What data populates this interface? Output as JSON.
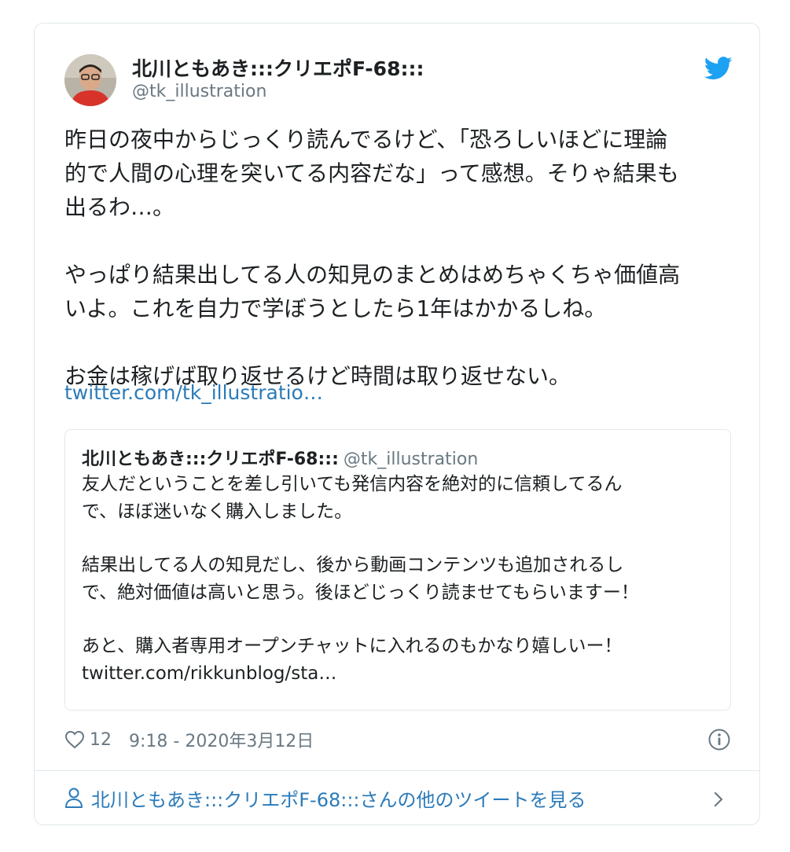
{
  "tweet": {
    "author_name": "北川ともあき:::クリエポF-68:::",
    "author_handle": "@tk_illustration",
    "text_lines": [
      "昨日の夜中からじっくり読んでるけど、「恐ろしいほどに理論",
      "的で人間の心理を突いてる内容だな」って感想。そりゃ結果も",
      "出るわ…。",
      "やっぱり結果出してる人の知見のまとめはめちゃくちゃ価値高",
      "いよ。これを自力で学ぼうとしたら1年はかかるしね。",
      "お金は稼げば取り返せるけど時間は取り返せない。"
    ],
    "link": "twitter.com/tk_illustratio…",
    "likes": "12",
    "timestamp": "9:18 - 2020年3月12日"
  },
  "quoted": {
    "author_name": "北川ともあき:::クリエポF-68:::",
    "author_handle": "@tk_illustration",
    "lines": [
      "友人だということを差し引いても発信内容を絶対的に信頼してるん",
      "で、ほぼ迷いなく購入しました。",
      "結果出してる人の知見だし、後から動画コンテンツも追加されるし",
      "で、絶対価値は高いと思う。後ほどじっくり読ませてもらいますー！",
      "あと、購入者専用オープンチャットに入れるのもかなり嬉しいー！",
      "twitter.com/rikkunblog/sta…"
    ]
  },
  "footer": {
    "more_link": "北川ともあき:::クリエポF-68:::さんの他のツイートを見る"
  },
  "icons": {
    "brand": "twitter-bird-icon",
    "like": "heart-icon",
    "info": "info-icon",
    "profile": "person-icon",
    "next": "chevron-right-icon"
  },
  "colors": {
    "brand_blue": "#1da1f2",
    "link_blue": "#2b7bb9",
    "text": "#1c2022",
    "secondary": "#697882",
    "border": "#e1e8ed"
  }
}
